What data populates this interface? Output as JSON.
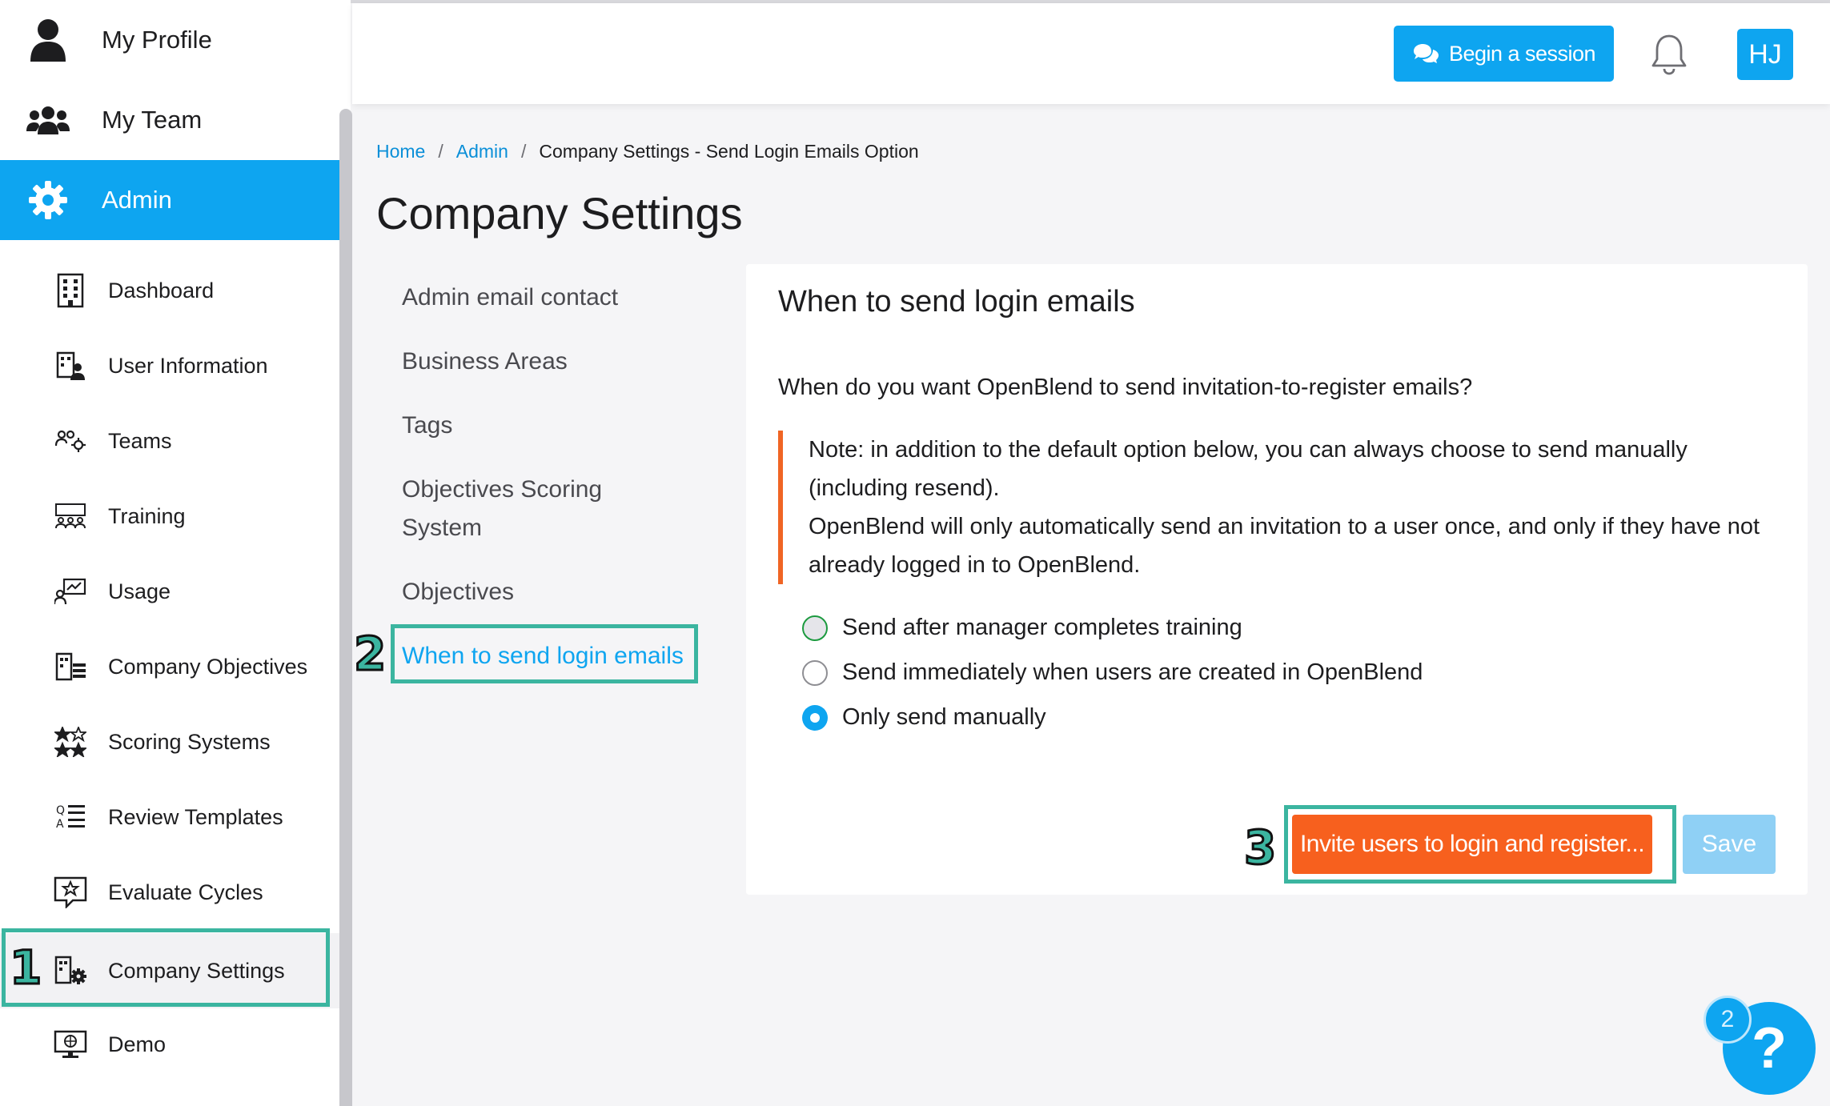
{
  "header": {
    "begin_session_label": "Begin a session",
    "avatar_initials": "HJ"
  },
  "sidebar": {
    "top_items": [
      {
        "label": "My Profile",
        "icon": "user-icon"
      },
      {
        "label": "My Team",
        "icon": "team-icon"
      },
      {
        "label": "Admin",
        "icon": "gear-icon",
        "active": true
      }
    ],
    "admin_items": [
      {
        "label": "Dashboard",
        "icon": "building-icon"
      },
      {
        "label": "User Information",
        "icon": "user-info-icon"
      },
      {
        "label": "Teams",
        "icon": "teams-icon"
      },
      {
        "label": "Training",
        "icon": "training-icon"
      },
      {
        "label": "Usage",
        "icon": "usage-icon"
      },
      {
        "label": "Company Objectives",
        "icon": "company-objectives-icon"
      },
      {
        "label": "Scoring Systems",
        "icon": "stars-icon"
      },
      {
        "label": "Review Templates",
        "icon": "review-templates-icon"
      },
      {
        "label": "Evaluate Cycles",
        "icon": "evaluate-cycles-icon"
      },
      {
        "label": "Company Settings",
        "icon": "company-settings-icon",
        "selected": true
      },
      {
        "label": "Demo",
        "icon": "monitor-icon"
      }
    ]
  },
  "breadcrumb": {
    "home": "Home",
    "admin": "Admin",
    "current": "Company Settings - Send Login Emails Option",
    "separator": "/"
  },
  "page": {
    "title": "Company Settings"
  },
  "settings_nav": {
    "items": [
      {
        "label": "Admin email contact"
      },
      {
        "label": "Business Areas"
      },
      {
        "label": "Tags"
      },
      {
        "label": "Objectives Scoring",
        "label2": "System"
      },
      {
        "label": "Objectives"
      },
      {
        "label": "When to send login emails",
        "active": true
      }
    ]
  },
  "card": {
    "title": "When to send login emails",
    "question": "When do you want OpenBlend to send invitation-to-register emails?",
    "note_line1": "Note: in addition to the default option below, you can always choose to send manually (including resend).",
    "note_line2": "OpenBlend will only automatically send an invitation to a user once, and only if they have not already logged in to OpenBlend.",
    "options": [
      {
        "label": "Send after manager completes training",
        "checked": false
      },
      {
        "label": "Send immediately when users are created in OpenBlend",
        "checked": false
      },
      {
        "label": "Only send manually",
        "checked": true
      }
    ],
    "invite_label": "Invite users to login and register...",
    "save_label": "Save"
  },
  "markers": {
    "one": "1",
    "two": "2",
    "three": "3"
  },
  "help": {
    "badge_count": "2",
    "symbol": "?"
  },
  "colors": {
    "accent": "#0ea5f0",
    "orange": "#f7601e",
    "highlight": "#3bb5a0"
  }
}
